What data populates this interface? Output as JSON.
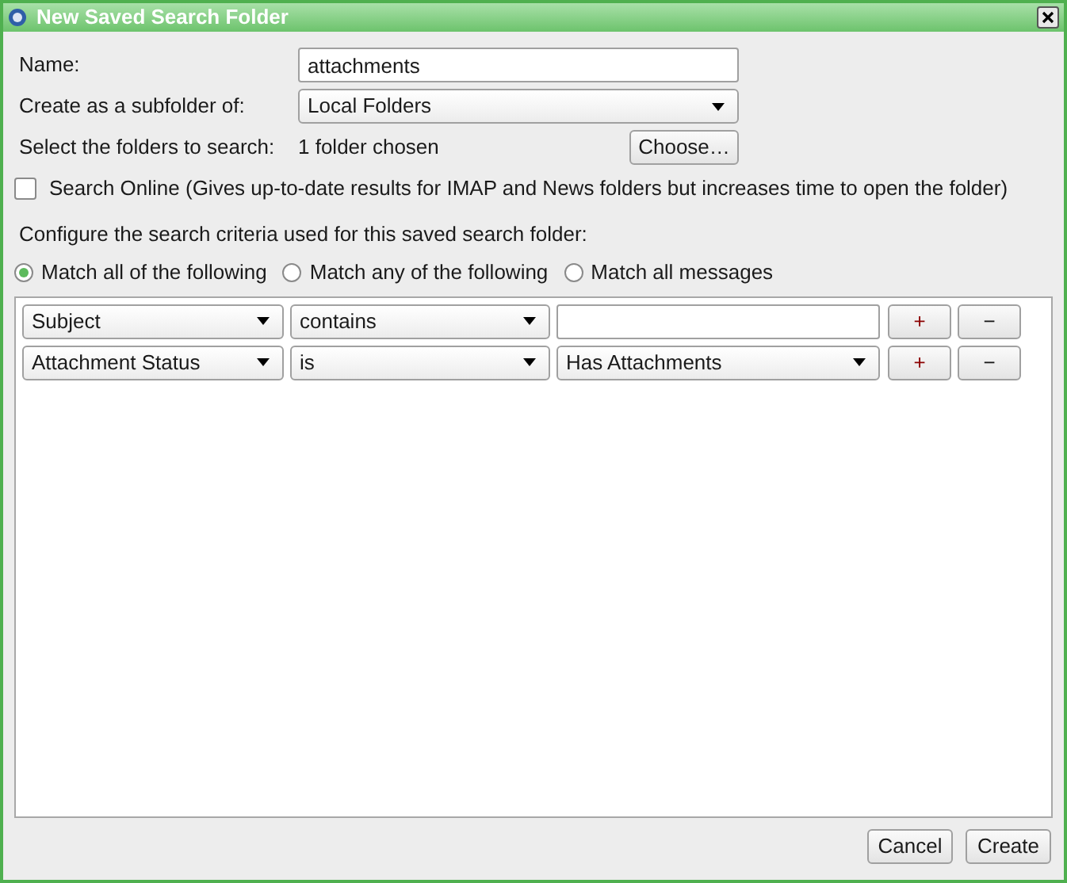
{
  "window": {
    "title": "New Saved Search Folder"
  },
  "name_field": {
    "label": "Name:",
    "value": "attachments"
  },
  "subfolder": {
    "label": "Create as a subfolder of:",
    "value": "Local Folders"
  },
  "folders": {
    "label": "Select the folders to search:",
    "value": "1 folder chosen",
    "button": "Choose…"
  },
  "search_online": {
    "label": "Search Online (Gives up-to-date results for IMAP and News folders but increases time to open the folder)",
    "checked": false
  },
  "criteria_heading": "Configure the search criteria used for this saved search folder:",
  "match_options": [
    {
      "label": "Match all of the following",
      "selected": true
    },
    {
      "label": "Match any of the following",
      "selected": false
    },
    {
      "label": "Match all messages",
      "selected": false
    }
  ],
  "criteria": [
    {
      "attribute": "Subject",
      "operator": "contains",
      "value": {
        "kind": "text"
      },
      "add": "+",
      "remove": "−"
    },
    {
      "attribute": "Attachment Status",
      "operator": "is",
      "value": {
        "kind": "dropdown",
        "text": "Has Attachments"
      },
      "add": "+",
      "remove": "−"
    }
  ],
  "buttons": [
    "Cancel",
    "Create"
  ]
}
